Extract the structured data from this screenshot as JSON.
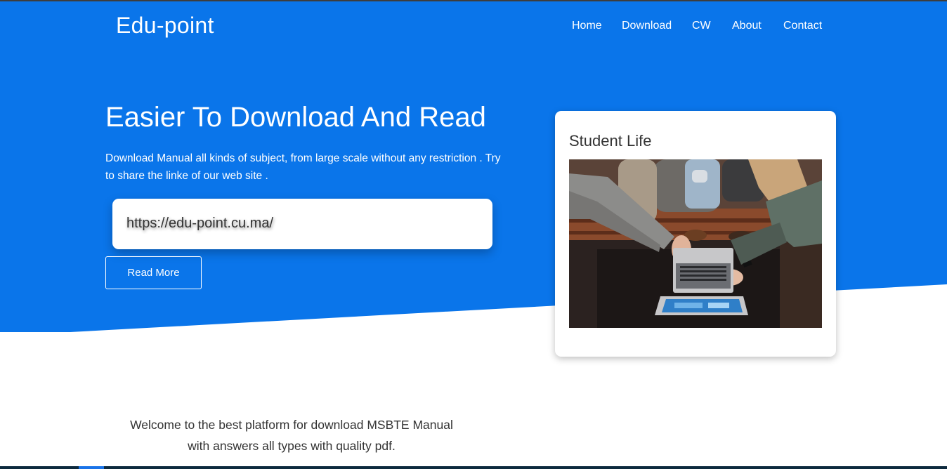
{
  "header": {
    "brand": "Edu-point",
    "nav": [
      "Home",
      "Download",
      "CW",
      "About",
      "Contact"
    ]
  },
  "hero": {
    "title": "Easier To Download And Read",
    "description": "Download Manual all kinds of subject, from large scale without any restriction . Try to share the linke of our web site .",
    "url": "https://edu-point.cu.ma/",
    "button_label": "Read More"
  },
  "card": {
    "title": "Student Life"
  },
  "welcome": {
    "line1": "Welcome to the best platform for download MSBTE Manual",
    "line2": "with answers all types with quality pdf."
  },
  "colors": {
    "hero_blue": "#0a75ea",
    "text_dark": "#333333",
    "white": "#ffffff"
  }
}
